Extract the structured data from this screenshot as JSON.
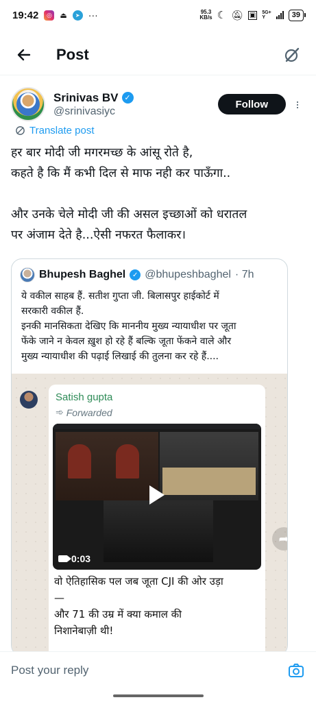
{
  "status_bar": {
    "time": "19:42",
    "net_speed_value": "95.3",
    "net_speed_unit": "KB/s",
    "network_top": "5G+",
    "network_bottom": "Y",
    "battery": "39"
  },
  "header": {
    "title": "Post"
  },
  "post": {
    "author_name": "Srinivas BV",
    "author_handle": "@srinivasiyc",
    "follow_label": "Follow",
    "translate_label": "Translate post",
    "text_lines": [
      "हर बार मोदी जी मगरमच्छ के आंसू रोते है,",
      "कहते है कि मैं कभी दिल से माफ नही कर पाऊँगा..",
      "",
      "और उनके चेले मोदी जी की असल इच्छाओं को धरातल",
      "पर अंजाम देते है...ऐसी नफरत फैलाकर।"
    ]
  },
  "quote": {
    "author_name": "Bhupesh Baghel",
    "author_handle": "@bhupeshbaghel",
    "time": "· 7h",
    "text_lines": [
      "ये वकील साहब हैं. सतीश गुप्ता जी. बिलासपुर हाईकोर्ट में",
      "सरकारी वकील हैं.",
      "इनकी मानसिकता देखिए कि माननीय मुख्य न्यायाधीश पर जूता",
      "फेंके जाने न केवल ख़ुश हो रहे हैं बल्कि जूता फेंकने वाले और",
      "मुख्य न्यायाधीश की पढ़ाई लिखाई की तुलना कर रहे हैं...."
    ],
    "media": {
      "sender": "Satish gupta",
      "forwarded_label": "Forwarded",
      "video_duration": "0:03",
      "caption_lines": [
        "वो ऐतिहासिक पल जब जूता CJI की ओर उड़ा",
        "—",
        " और 71 की उम्र में क्या कमाल की",
        "निशानेबाज़ी थी!"
      ]
    }
  },
  "reply": {
    "placeholder": "Post your reply"
  }
}
